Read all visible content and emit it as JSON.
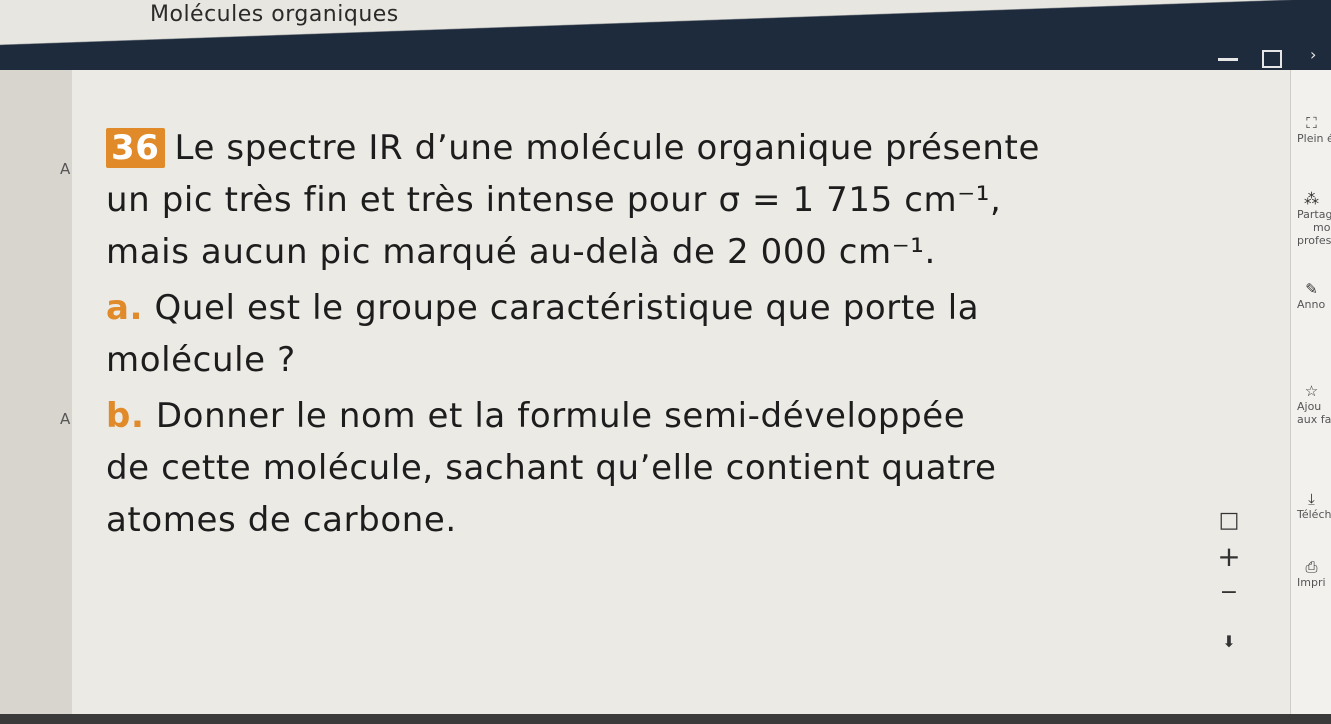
{
  "app": {
    "title": "Molécules organiques"
  },
  "exercise": {
    "number": "36",
    "intro": {
      "line1": "Le spectre IR d’une molécule organique présente",
      "line2": "un pic très fin et très intense pour",
      "sigma": "σ = 1 715 cm⁻¹,",
      "line3a": "mais aucun pic marqué au-delà de",
      "value2": "2 000 cm⁻¹."
    },
    "part_a": {
      "label": "a.",
      "line1": "Quel est le groupe caractéristique que porte la",
      "line2": "molécule ?"
    },
    "part_b": {
      "label": "b.",
      "line1": "Donner le nom et la formule semi-développée",
      "line2": "de cette molécule, sachant qu’elle contient quatre",
      "line3": "atomes de carbone."
    }
  },
  "side_markers": [
    "A",
    "A"
  ],
  "right_panel": [
    {
      "icon": "fullscreen-icon",
      "glyph": "⛶",
      "label": "Plein éc"
    },
    {
      "icon": "share-icon",
      "glyph": "⁂",
      "label": "Partag"
    },
    {
      "icon": "share-sub",
      "glyph": "",
      "label": "mo"
    },
    {
      "icon": "share-sub2",
      "glyph": "",
      "label": "profes"
    },
    {
      "icon": "annotate-icon",
      "glyph": "✎",
      "label": "Anno"
    },
    {
      "icon": "favorite-icon",
      "glyph": "☆",
      "label": "Ajou"
    },
    {
      "icon": "favorite-sub",
      "glyph": "",
      "label": "aux fa"
    },
    {
      "icon": "download-icon",
      "glyph": "⤓",
      "label": "Téléch"
    },
    {
      "icon": "print-icon",
      "glyph": "⎙",
      "label": "Impri"
    }
  ],
  "zoom": {
    "fit": "□",
    "plus": "+",
    "minus": "−",
    "down": "⬇"
  }
}
